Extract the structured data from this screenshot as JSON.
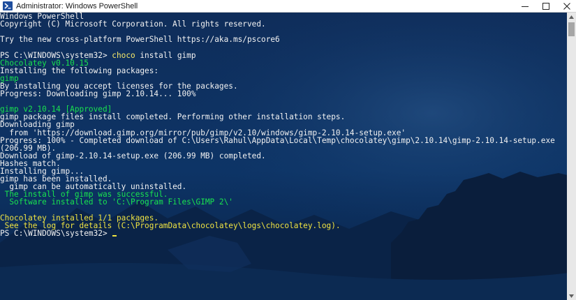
{
  "window": {
    "title": "Administrator: Windows PowerShell",
    "icons": {
      "app": "powershell-icon",
      "minimize": "minimize-icon",
      "maximize": "maximize-icon",
      "close": "close-icon"
    }
  },
  "terminal": {
    "lines": [
      {
        "text": "Windows PowerShell",
        "color": "#f2f2f2"
      },
      {
        "text": "Copyright (C) Microsoft Corporation. All rights reserved.",
        "color": "#f2f2f2"
      },
      {
        "text": "",
        "color": "#f2f2f2"
      },
      {
        "text": "Try the new cross-platform PowerShell https://aka.ms/pscore6",
        "color": "#f2f2f2"
      },
      {
        "text": "",
        "color": "#f2f2f2"
      },
      {
        "prompt": "PS C:\\WINDOWS\\system32> ",
        "command": "choco",
        "args": " install gimp"
      },
      {
        "text": "Chocolatey v0.10.15",
        "color": "#19e34f"
      },
      {
        "text": "Installing the following packages:",
        "color": "#f2f2f2"
      },
      {
        "text": "gimp",
        "color": "#19e34f"
      },
      {
        "text": "By installing you accept licenses for the packages.",
        "color": "#f2f2f2"
      },
      {
        "text": "Progress: Downloading gimp 2.10.14... 100%",
        "color": "#f2f2f2"
      },
      {
        "text": "",
        "color": "#f2f2f2"
      },
      {
        "text": "gimp v2.10.14 [Approved]",
        "color": "#19e34f"
      },
      {
        "text": "gimp package files install completed. Performing other installation steps.",
        "color": "#f2f2f2"
      },
      {
        "text": "Downloading gimp",
        "color": "#f2f2f2"
      },
      {
        "text": "  from 'https://download.gimp.org/mirror/pub/gimp/v2.10/windows/gimp-2.10.14-setup.exe'",
        "color": "#f2f2f2"
      },
      {
        "text": "Progress: 100% - Completed download of C:\\Users\\Rahul\\AppData\\Local\\Temp\\chocolatey\\gimp\\2.10.14\\gimp-2.10.14-setup.exe",
        "color": "#f2f2f2"
      },
      {
        "text": "(206.99 MB).",
        "color": "#f2f2f2"
      },
      {
        "text": "Download of gimp-2.10.14-setup.exe (206.99 MB) completed.",
        "color": "#f2f2f2"
      },
      {
        "text": "Hashes match.",
        "color": "#f2f2f2"
      },
      {
        "text": "Installing gimp...",
        "color": "#f2f2f2"
      },
      {
        "text": "gimp has been installed.",
        "color": "#f2f2f2"
      },
      {
        "text": "  gimp can be automatically uninstalled.",
        "color": "#f2f2f2"
      },
      {
        "text": " The install of gimp was successful.",
        "color": "#19e34f"
      },
      {
        "text": "  Software installed to 'C:\\Program Files\\GIMP 2\\'",
        "color": "#19e34f"
      },
      {
        "text": "",
        "color": "#f2f2f2"
      },
      {
        "text": "Chocolatey installed 1/1 packages.",
        "color": "#f0e442"
      },
      {
        "text": " See the log for details (C:\\ProgramData\\chocolatey\\logs\\chocolatey.log).",
        "color": "#f0e442"
      },
      {
        "prompt": "PS C:\\WINDOWS\\system32> ",
        "cursor": true
      }
    ]
  },
  "colors": {
    "background": "#0b2a55",
    "command": "#f5e96a",
    "cursor": "#f0e442",
    "scrollbar_track": "#e8e8e8",
    "scrollbar_thumb": "#a6a6a6"
  }
}
